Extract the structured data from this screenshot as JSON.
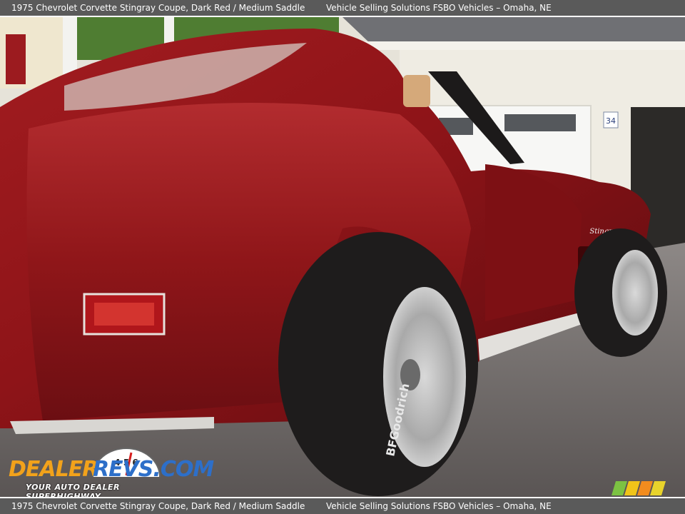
{
  "header": {
    "caption": "1975 Chevrolet Corvette Stingray Coupe,   Dark Red / Medium Saddle",
    "dealer": "Vehicle Selling Solutions FSBO Vehicles – Omaha, NE"
  },
  "footer": {
    "caption": "1975 Chevrolet Corvette Stingray Coupe,   Dark Red / Medium Saddle",
    "dealer": "Vehicle Selling Solutions FSBO Vehicles – Omaha, NE"
  },
  "watermark": {
    "brand_part1": "DEALER",
    "brand_part2": "REVS.COM",
    "tagline": "YOUR AUTO DEALER SUPERHIGHWAY",
    "gauge_digits": "4 5 6"
  },
  "scene": {
    "house_number": "34",
    "badge": "Stingray",
    "tire_brand": "BFGoodrich"
  },
  "colors": {
    "car_body": "#8e1418",
    "car_highlight": "#c23a3a",
    "tire": "#1e1c1c",
    "rim": "#b9b9b9",
    "pavers": "#7a7574",
    "house": "#e9e6dc",
    "foliage": "#4f7d32",
    "bar": "#5a5a5a"
  }
}
